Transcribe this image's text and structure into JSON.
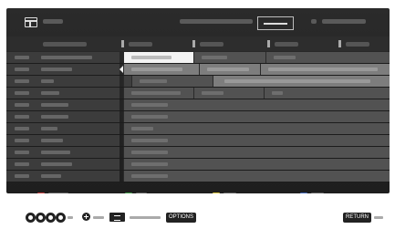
{
  "legend": {
    "options_label": "OPTIONS",
    "return_label": "RETURN"
  },
  "colors": {
    "key_red": "#c43c3c",
    "key_green": "#3f9a46",
    "key_yellow": "#d8c23c",
    "key_blue": "#3d62b6",
    "selected_programme": "#f4f4f4"
  },
  "icons": [
    "guide-icon",
    "button-a-icon",
    "button-b-icon",
    "button-c-icon",
    "button-d-icon",
    "plus-icon",
    "key-icon"
  ]
}
